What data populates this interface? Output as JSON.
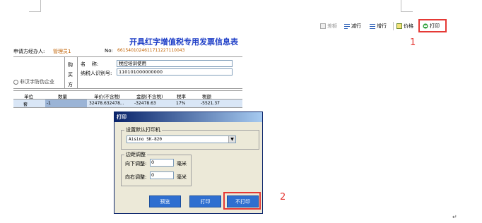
{
  "toolbar": {
    "items": [
      {
        "label": "差额",
        "enabled": false
      },
      {
        "label": "减行",
        "enabled": true
      },
      {
        "label": "增行",
        "enabled": true
      },
      {
        "label": "价格",
        "enabled": true
      },
      {
        "label": "打印",
        "enabled": true
      }
    ]
  },
  "form": {
    "title": "开具红字增值税专用发票信息表",
    "applicant_label": "申请方经办人:",
    "applicant_value": "管理员1",
    "no_label": "No:",
    "no_value": "6615401024611711227110043",
    "buyer_side_label": [
      "购",
      "买",
      "方"
    ],
    "name_label": "名    称:",
    "name_value": "税控培训使用",
    "taxid_label": "纳税人识别号:",
    "taxid_value": "110101000000000",
    "non_anti_fake_label": "非汉字防伪企业",
    "columns": [
      "单位",
      "数量",
      "单价(不含税)",
      "金额(不含税)",
      "税率",
      "税额"
    ],
    "row": [
      "套",
      "-1",
      "32478.632478...",
      "-32478.63",
      "17%",
      "-5521.37"
    ]
  },
  "dialog": {
    "title": "打印",
    "printer_group_label": "设置默认打印机",
    "printer_value": "Aisino SK-820",
    "margin_group_label": "边距调整",
    "down_label": "向下调整:",
    "down_value": "0",
    "right_label": "向右调整:",
    "right_value": "0",
    "unit_mm": "毫米",
    "preview_button": "预览",
    "print_button": "打印",
    "no_print_button": "不打印"
  },
  "annotations": {
    "marker_1": "1",
    "marker_2": "2"
  },
  "colors": {
    "highlight_red": "#e53935",
    "title_blue": "#1f3fc7",
    "button_blue": "#2f6fd0",
    "dialog_title_bg": "#0a246a"
  }
}
